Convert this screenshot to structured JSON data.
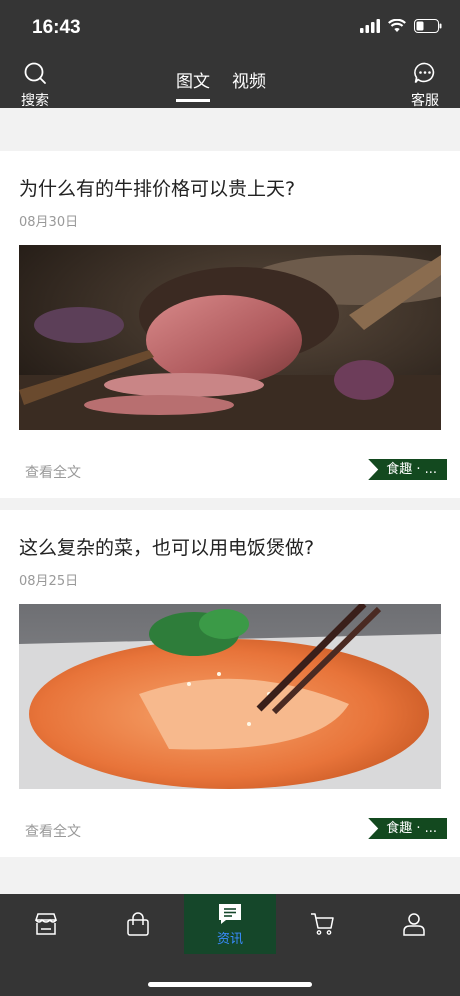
{
  "status": {
    "time": "16:43"
  },
  "nav": {
    "search_label": "搜索",
    "service_label": "客服",
    "tabs": [
      {
        "label": "图文",
        "active": true
      },
      {
        "label": "视频",
        "active": false
      }
    ]
  },
  "articles": [
    {
      "title": "为什么有的牛排价格可以贵上天?",
      "date": "08月30日",
      "read_more": "查看全文",
      "tag": "食趣 · ..."
    },
    {
      "title": "这么复杂的菜，也可以用电饭煲做?",
      "date": "08月25日",
      "read_more": "查看全文",
      "tag": "食趣 · ..."
    }
  ],
  "tabbar": {
    "items": [
      {
        "icon": "store-icon",
        "label": ""
      },
      {
        "icon": "bag-icon",
        "label": ""
      },
      {
        "icon": "news-icon",
        "label": "资讯",
        "active": true
      },
      {
        "icon": "cart-icon",
        "label": ""
      },
      {
        "icon": "user-icon",
        "label": ""
      }
    ]
  },
  "colors": {
    "bar": "#353535",
    "accent_green": "#13491f",
    "tab_active_text": "#3a8cff"
  }
}
